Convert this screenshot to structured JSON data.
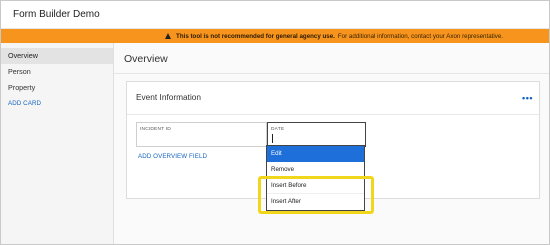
{
  "app": {
    "title": "Form Builder Demo"
  },
  "banner": {
    "warning_text": "This tool is not recommended for general agency use.",
    "info_text": "For additional information, contact your Axon representative.",
    "icon": "warning-triangle-icon",
    "color": "#f7941d"
  },
  "sidebar": {
    "items": [
      {
        "label": "Overview",
        "active": true
      },
      {
        "label": "Person"
      },
      {
        "label": "Property"
      }
    ],
    "add_card_label": "ADD CARD"
  },
  "main": {
    "title": "Overview",
    "card": {
      "title": "Event Information",
      "menu_icon": "more-horizontal-icon",
      "fields": [
        {
          "label": "INCIDENT ID"
        },
        {
          "label": "DATE"
        }
      ],
      "add_field_label": "ADD OVERVIEW FIELD"
    }
  },
  "context_menu": {
    "items": [
      {
        "label": "Edit",
        "selected": true
      },
      {
        "label": "Remove"
      },
      {
        "label": "Insert Before"
      },
      {
        "label": "Insert After"
      }
    ]
  },
  "colors": {
    "accent": "#1565c0",
    "selection": "#1e6fd9",
    "highlight": "#f2d61b"
  }
}
